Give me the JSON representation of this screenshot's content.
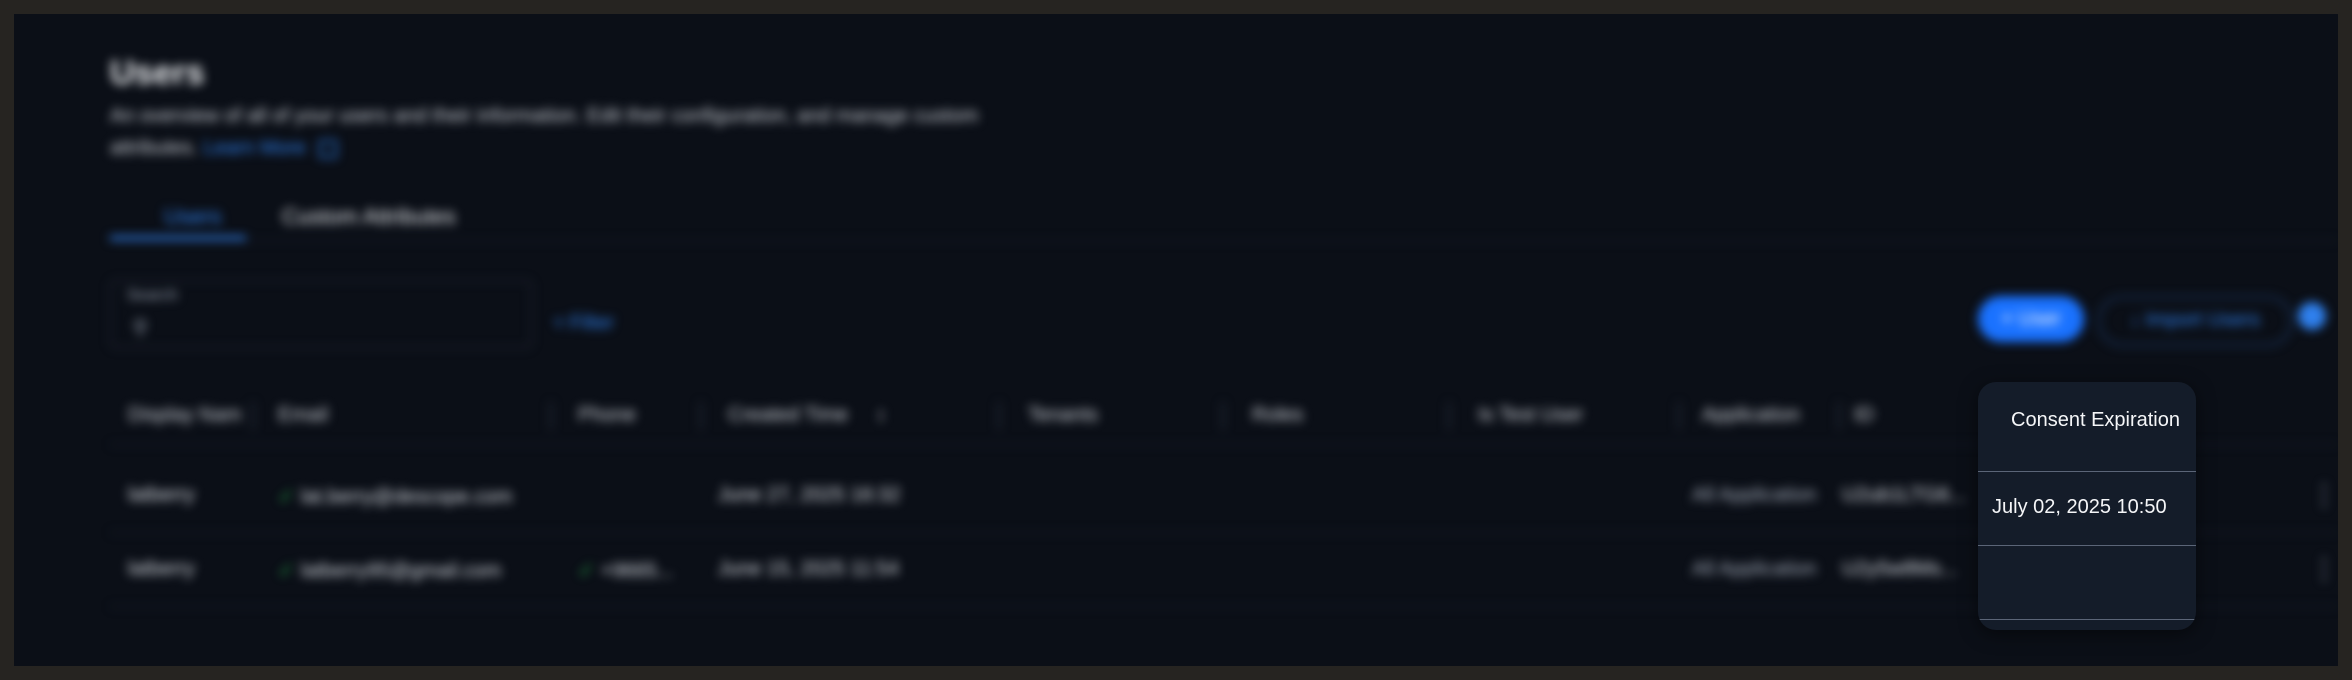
{
  "page": {
    "title": "Users",
    "subtitle": "An overview of all of your users and their information. Edit their configuration, and manage custom attributes.",
    "learn_more": "Learn More"
  },
  "tabs": [
    {
      "label": "Users",
      "active": true
    },
    {
      "label": "Custom Attributes",
      "active": false
    }
  ],
  "toolbar": {
    "search_label": "Search",
    "filter_label": "Filter",
    "add_user_label": "User",
    "import_label": "Import Users"
  },
  "table": {
    "columns": [
      "Display Nam",
      "Email",
      "Phone",
      "Created Time",
      "Tenants",
      "Roles",
      "Is Test User",
      "Application",
      "ID",
      "Consent Expiration"
    ],
    "rows": [
      {
        "display_name": "latberry",
        "email": "lat.berry@descope.com",
        "phone": "",
        "created": "June 27, 2025 16:32",
        "application": "All Application",
        "id": "U2ub1LTG6...",
        "consent_expiration": "July 02, 2025 10:50"
      },
      {
        "display_name": "latberry",
        "email": "latberry95@gmail.com",
        "phone": "+9665...",
        "created": "June 15, 2025 11:54",
        "application": "All Application",
        "id": "U2y5w8Ms...",
        "consent_expiration": ""
      }
    ]
  },
  "colors": {
    "accent": "#1a72ff",
    "background": "#0b0f17",
    "popover_bg": "#141c29",
    "success": "#28b34b"
  }
}
